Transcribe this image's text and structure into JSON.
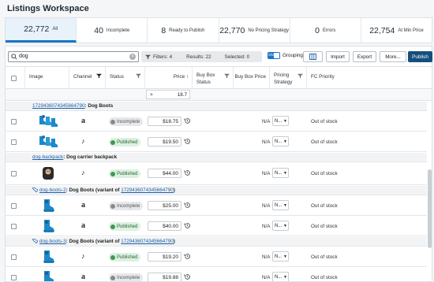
{
  "title": "Listings Workspace",
  "stats": [
    {
      "num": "22,772",
      "label": "All",
      "active": true
    },
    {
      "num": "40",
      "label": "Incomplete"
    },
    {
      "num": "8",
      "label": "Ready to Publish"
    },
    {
      "num": "22,770",
      "label": "No Pricing Strategy"
    },
    {
      "num": "0",
      "label": "Errors"
    },
    {
      "num": "22,754",
      "label": "At Min Price"
    }
  ],
  "search": {
    "value": "dog",
    "clear": "×"
  },
  "filterbar": {
    "filters": "Filters: 4",
    "results": "Results: 22",
    "selected": "Selected: 0"
  },
  "toggle": {
    "on": "ON",
    "label": "Grouping"
  },
  "buttons": {
    "import": "Import",
    "export": "Export",
    "more": "More...",
    "publish": "Publish"
  },
  "columns": {
    "image": "Image",
    "channel": "Channel",
    "status": "Status",
    "price": "Price ↑",
    "buybox_status": "Buy Box Status",
    "buybox_price": "Buy Box Price",
    "pricing_strategy": "Pricing Strategy",
    "fc_priority": "FC Priority"
  },
  "price_filter": {
    "op": ">",
    "value": "18.7"
  },
  "groups": [
    {
      "link": "1729436074345664790",
      "suffix": ": Dog Boots",
      "prefix": "",
      "tagged": false,
      "variant_of": ""
    },
    {
      "link": "dog-backpack",
      "suffix": ": Dog carrier backpack",
      "prefix": "",
      "tagged": false
    },
    {
      "link": "dog-boots-2",
      "suffix": ": Dog Boots (variant of ",
      "variant_link": "1729436074345664790",
      "end": ")",
      "tagged": true
    },
    {
      "link": "dog-boots-3",
      "suffix": ": Dog Boots (variant of ",
      "variant_link": "1729436074345664790",
      "end": ")",
      "tagged": true
    }
  ],
  "rows": [
    {
      "channel": "a",
      "channel_icon": "amazon-icon",
      "status": "Incomplete",
      "status_type": "inc",
      "price": "$18.75",
      "buybox_price": "N/A",
      "strategy": "N...",
      "fc": "Out of stock",
      "image": "blue-boots"
    },
    {
      "channel": "♪",
      "channel_icon": "tiktok-icon",
      "status": "Published",
      "status_type": "pub",
      "price": "$19.50",
      "buybox_price": "N/A",
      "strategy": "N...",
      "fc": "Out of stock",
      "image": "blue-boots"
    },
    {
      "channel": "♪",
      "channel_icon": "tiktok-icon",
      "status": "Published",
      "status_type": "pub",
      "price": "$44.00",
      "buybox_price": "N/A",
      "strategy": "N...",
      "fc": "Out of stock",
      "image": "dog-backpack"
    },
    {
      "channel": "a",
      "channel_icon": "amazon-icon",
      "status": "Incomplete",
      "status_type": "inc",
      "price": "$25.00",
      "buybox_price": "N/A",
      "strategy": "N...",
      "fc": "Out of stock",
      "image": "boot-single"
    },
    {
      "channel": "a",
      "channel_icon": "amazon-icon",
      "status": "Published",
      "status_type": "pub",
      "price": "$40.00",
      "buybox_price": "N/A",
      "strategy": "N...",
      "fc": "Out of stock",
      "image": "boot-single"
    },
    {
      "channel": "♪",
      "channel_icon": "tiktok-icon",
      "status": "Published",
      "status_type": "pub",
      "price": "$19.20",
      "buybox_price": "N/A",
      "strategy": "N...",
      "fc": "Out of stock",
      "image": "boot-single"
    },
    {
      "channel": "a",
      "channel_icon": "amazon-icon",
      "status": "Incomplete",
      "status_type": "inc",
      "price": "$19.88",
      "buybox_price": "N/A",
      "strategy": "N...",
      "fc": "Out of stock",
      "image": "boot-single"
    }
  ],
  "colors": {
    "accent": "#1b76c6",
    "primary": "#14507d",
    "published": "#3b9a54"
  }
}
